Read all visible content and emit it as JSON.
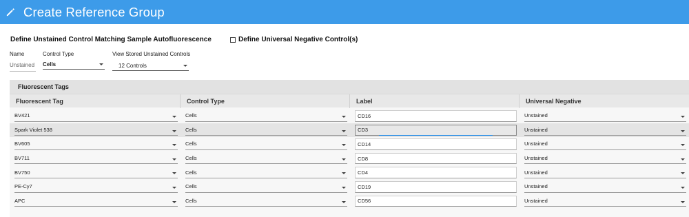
{
  "header": {
    "title": "Create Reference Group"
  },
  "section": {
    "title": "Define Unstained Control Matching Sample Autofluorescence",
    "universal_negative_label": "Define Universal Negative Control(s)"
  },
  "fields": {
    "name_label": "Name",
    "name_value": "Unstained",
    "control_type_label": "Control Type",
    "control_type_value": "Cells",
    "stored_controls_label": "View Stored Unstained Controls",
    "stored_controls_value": "12 Controls"
  },
  "panel": {
    "title": "Fluorescent Tags",
    "columns": [
      "Fluorescent Tag",
      "Control Type",
      "Label",
      "Universal Negative"
    ],
    "rows": [
      {
        "tag": "BV421",
        "control": "Cells",
        "label": "CD16",
        "negative": "Unstained"
      },
      {
        "tag": "Spark Violet 538",
        "control": "Cells",
        "label": "CD3",
        "negative": "Unstained"
      },
      {
        "tag": "BV605",
        "control": "Cells",
        "label": "CD14",
        "negative": "Unstained"
      },
      {
        "tag": "BV711",
        "control": "Cells",
        "label": "CD8",
        "negative": "Unstained"
      },
      {
        "tag": "BV750",
        "control": "Cells",
        "label": "CD4",
        "negative": "Unstained"
      },
      {
        "tag": "PE-Cy7",
        "control": "Cells",
        "label": "CD19",
        "negative": "Unstained"
      },
      {
        "tag": "APC",
        "control": "Cells",
        "label": "CD56",
        "negative": "Unstained"
      }
    ]
  },
  "icons": {
    "header_icon": "pencil-icon",
    "dropdown_icon": "caret-down-icon"
  },
  "colors": {
    "accent": "#3d9be9",
    "focus": "#1e88e5"
  }
}
